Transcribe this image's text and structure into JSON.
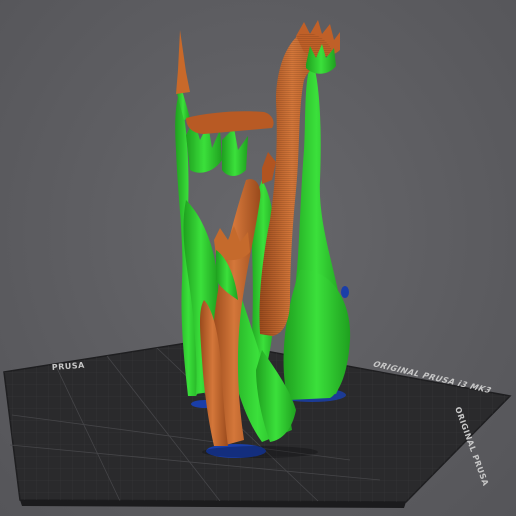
{
  "viewport": {
    "name": "3D slicer preview",
    "bed": {
      "label_primary": "ORIGINAL PRUSA i3 MK3",
      "label_secondary": "PRUSA",
      "label_tertiary": "ORIGINAL PRUSA"
    },
    "colors": {
      "background": "#5c5c60",
      "bed_surface": "#2b2b2d",
      "bed_grid": "#3a3a3c",
      "model_orange": "#c8692a",
      "model_orange_dark": "#8f4518",
      "support_green": "#2fd12f",
      "support_green_dark": "#1f9a1f",
      "brim_blue": "#1a3ea8"
    }
  }
}
